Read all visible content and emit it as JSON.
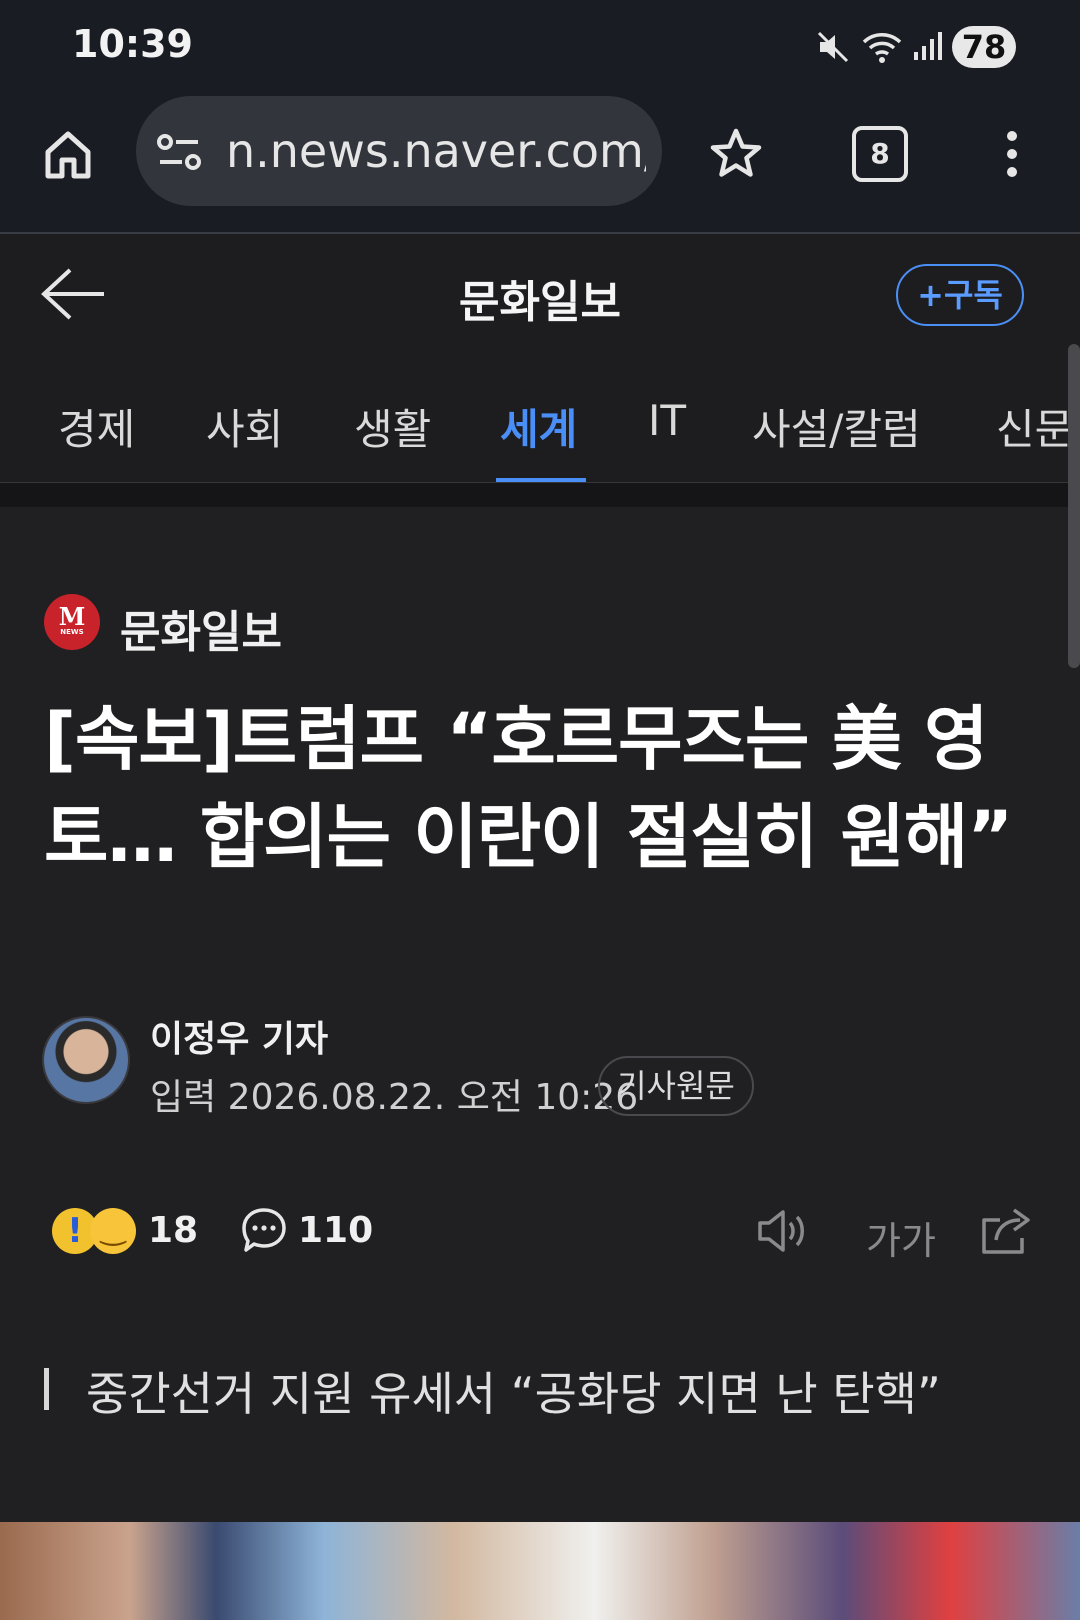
{
  "status_bar": {
    "time": "10:39",
    "battery": "78"
  },
  "browser": {
    "url": "n.news.naver.com/a",
    "tab_count": "8"
  },
  "header": {
    "title": "문화일보",
    "subscribe_label": "+구독"
  },
  "categories": [
    "경제",
    "사회",
    "생활",
    "세계",
    "IT",
    "사설/칼럼",
    "신문"
  ],
  "active_category": "세계",
  "article": {
    "publisher": "문화일보",
    "publisher_logo_letter": "M",
    "publisher_logo_sub": "NEWS",
    "headline": "[속보]트럼프 “호르무즈는 美 영토… 합의는 이란이 절실히 원해”",
    "reporter": "이정우 기자",
    "published": "입력 2026.08.22. 오전 10:26",
    "original_label": "기사원문",
    "reaction_count": "18",
    "comment_count": "110",
    "font_size_label": "가가",
    "summary": "중간선거 지원 유세서 “공화당 지면 난 탄핵”"
  },
  "colors": {
    "accent": "#4a8ef7",
    "background": "#202022",
    "logo_red": "#c8222a"
  },
  "icons": [
    "home-icon",
    "site-info-icon",
    "star-icon",
    "tabs-icon",
    "more-icon",
    "back-arrow-icon",
    "comment-icon",
    "speaker-icon",
    "share-icon"
  ]
}
